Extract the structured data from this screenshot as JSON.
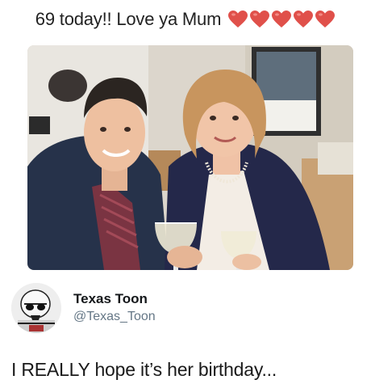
{
  "caption": {
    "text": "69 today!! Love ya Mum",
    "hearts": [
      "heart-icon",
      "heart-icon",
      "heart-icon",
      "heart-icon",
      "heart-icon"
    ],
    "heart_color": "#e0504a"
  },
  "photo": {
    "content": "selfie-photo"
  },
  "account": {
    "display_name": "Texas Toon",
    "handle": "@Texas_Toon",
    "avatar": "stormtrooper-avatar"
  },
  "tweet": {
    "text": "I REALLY hope it’s her birthday..."
  },
  "colors": {
    "handle": "#657786",
    "name": "#14171a"
  }
}
